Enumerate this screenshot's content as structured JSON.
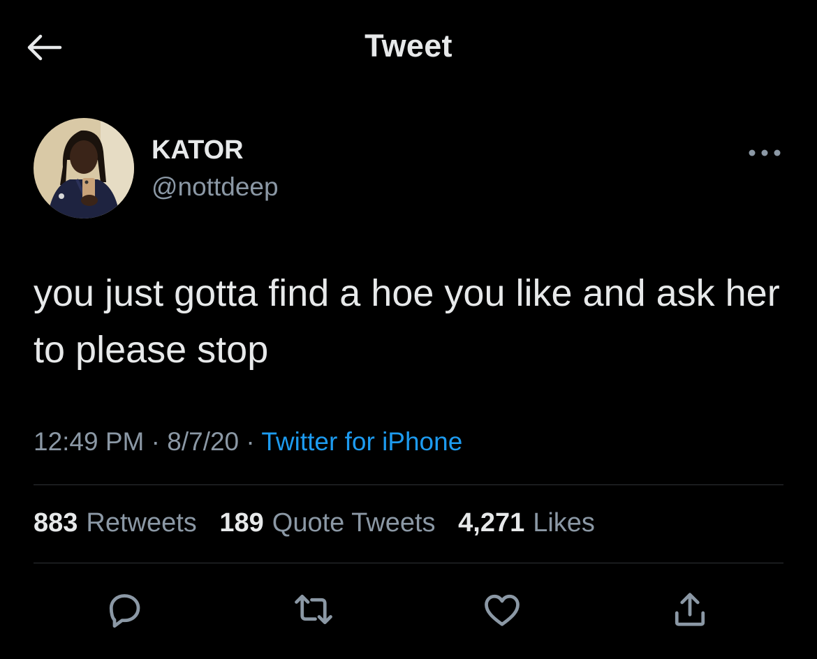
{
  "header": {
    "title": "Tweet"
  },
  "tweet": {
    "author": {
      "display_name": "KATOR",
      "handle": "@nottdeep"
    },
    "text": "you just gotta find a hoe you like and ask her to please stop",
    "time": "12:49 PM",
    "date": "8/7/20",
    "separator": "·",
    "source": "Twitter for iPhone"
  },
  "stats": {
    "retweets_count": "883",
    "retweets_label": "Retweets",
    "quotes_count": "189",
    "quotes_label": "Quote Tweets",
    "likes_count": "4,271",
    "likes_label": "Likes"
  },
  "icons": {
    "back": "arrow-left-icon",
    "more": "more-horizontal-icon",
    "reply": "reply-icon",
    "retweet": "retweet-icon",
    "like": "heart-icon",
    "share": "share-icon"
  },
  "colors": {
    "background": "#000000",
    "text_primary": "#e7e9ea",
    "text_secondary": "#8b98a5",
    "link": "#1d9bf0",
    "divider": "#2f3336"
  }
}
